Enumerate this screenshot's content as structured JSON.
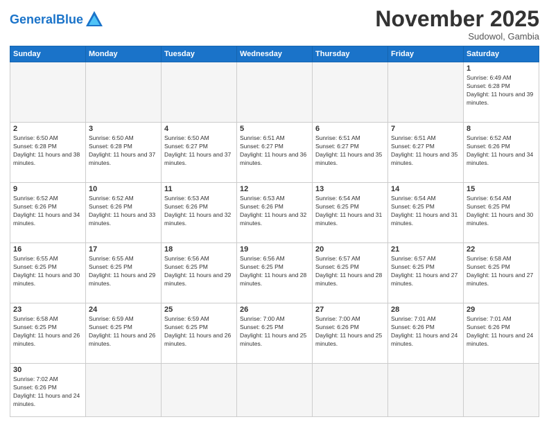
{
  "header": {
    "logo_general": "General",
    "logo_blue": "Blue",
    "month_title": "November 2025",
    "location": "Sudowol, Gambia"
  },
  "weekdays": [
    "Sunday",
    "Monday",
    "Tuesday",
    "Wednesday",
    "Thursday",
    "Friday",
    "Saturday"
  ],
  "weeks": [
    [
      {
        "day": "",
        "empty": true
      },
      {
        "day": "",
        "empty": true
      },
      {
        "day": "",
        "empty": true
      },
      {
        "day": "",
        "empty": true
      },
      {
        "day": "",
        "empty": true
      },
      {
        "day": "",
        "empty": true
      },
      {
        "day": "1",
        "sunrise": "Sunrise: 6:49 AM",
        "sunset": "Sunset: 6:28 PM",
        "daylight": "Daylight: 11 hours and 39 minutes."
      }
    ],
    [
      {
        "day": "2",
        "sunrise": "Sunrise: 6:50 AM",
        "sunset": "Sunset: 6:28 PM",
        "daylight": "Daylight: 11 hours and 38 minutes."
      },
      {
        "day": "3",
        "sunrise": "Sunrise: 6:50 AM",
        "sunset": "Sunset: 6:28 PM",
        "daylight": "Daylight: 11 hours and 37 minutes."
      },
      {
        "day": "4",
        "sunrise": "Sunrise: 6:50 AM",
        "sunset": "Sunset: 6:27 PM",
        "daylight": "Daylight: 11 hours and 37 minutes."
      },
      {
        "day": "5",
        "sunrise": "Sunrise: 6:51 AM",
        "sunset": "Sunset: 6:27 PM",
        "daylight": "Daylight: 11 hours and 36 minutes."
      },
      {
        "day": "6",
        "sunrise": "Sunrise: 6:51 AM",
        "sunset": "Sunset: 6:27 PM",
        "daylight": "Daylight: 11 hours and 35 minutes."
      },
      {
        "day": "7",
        "sunrise": "Sunrise: 6:51 AM",
        "sunset": "Sunset: 6:27 PM",
        "daylight": "Daylight: 11 hours and 35 minutes."
      },
      {
        "day": "8",
        "sunrise": "Sunrise: 6:52 AM",
        "sunset": "Sunset: 6:26 PM",
        "daylight": "Daylight: 11 hours and 34 minutes."
      }
    ],
    [
      {
        "day": "9",
        "sunrise": "Sunrise: 6:52 AM",
        "sunset": "Sunset: 6:26 PM",
        "daylight": "Daylight: 11 hours and 34 minutes."
      },
      {
        "day": "10",
        "sunrise": "Sunrise: 6:52 AM",
        "sunset": "Sunset: 6:26 PM",
        "daylight": "Daylight: 11 hours and 33 minutes."
      },
      {
        "day": "11",
        "sunrise": "Sunrise: 6:53 AM",
        "sunset": "Sunset: 6:26 PM",
        "daylight": "Daylight: 11 hours and 32 minutes."
      },
      {
        "day": "12",
        "sunrise": "Sunrise: 6:53 AM",
        "sunset": "Sunset: 6:26 PM",
        "daylight": "Daylight: 11 hours and 32 minutes."
      },
      {
        "day": "13",
        "sunrise": "Sunrise: 6:54 AM",
        "sunset": "Sunset: 6:25 PM",
        "daylight": "Daylight: 11 hours and 31 minutes."
      },
      {
        "day": "14",
        "sunrise": "Sunrise: 6:54 AM",
        "sunset": "Sunset: 6:25 PM",
        "daylight": "Daylight: 11 hours and 31 minutes."
      },
      {
        "day": "15",
        "sunrise": "Sunrise: 6:54 AM",
        "sunset": "Sunset: 6:25 PM",
        "daylight": "Daylight: 11 hours and 30 minutes."
      }
    ],
    [
      {
        "day": "16",
        "sunrise": "Sunrise: 6:55 AM",
        "sunset": "Sunset: 6:25 PM",
        "daylight": "Daylight: 11 hours and 30 minutes."
      },
      {
        "day": "17",
        "sunrise": "Sunrise: 6:55 AM",
        "sunset": "Sunset: 6:25 PM",
        "daylight": "Daylight: 11 hours and 29 minutes."
      },
      {
        "day": "18",
        "sunrise": "Sunrise: 6:56 AM",
        "sunset": "Sunset: 6:25 PM",
        "daylight": "Daylight: 11 hours and 29 minutes."
      },
      {
        "day": "19",
        "sunrise": "Sunrise: 6:56 AM",
        "sunset": "Sunset: 6:25 PM",
        "daylight": "Daylight: 11 hours and 28 minutes."
      },
      {
        "day": "20",
        "sunrise": "Sunrise: 6:57 AM",
        "sunset": "Sunset: 6:25 PM",
        "daylight": "Daylight: 11 hours and 28 minutes."
      },
      {
        "day": "21",
        "sunrise": "Sunrise: 6:57 AM",
        "sunset": "Sunset: 6:25 PM",
        "daylight": "Daylight: 11 hours and 27 minutes."
      },
      {
        "day": "22",
        "sunrise": "Sunrise: 6:58 AM",
        "sunset": "Sunset: 6:25 PM",
        "daylight": "Daylight: 11 hours and 27 minutes."
      }
    ],
    [
      {
        "day": "23",
        "sunrise": "Sunrise: 6:58 AM",
        "sunset": "Sunset: 6:25 PM",
        "daylight": "Daylight: 11 hours and 26 minutes."
      },
      {
        "day": "24",
        "sunrise": "Sunrise: 6:59 AM",
        "sunset": "Sunset: 6:25 PM",
        "daylight": "Daylight: 11 hours and 26 minutes."
      },
      {
        "day": "25",
        "sunrise": "Sunrise: 6:59 AM",
        "sunset": "Sunset: 6:25 PM",
        "daylight": "Daylight: 11 hours and 26 minutes."
      },
      {
        "day": "26",
        "sunrise": "Sunrise: 7:00 AM",
        "sunset": "Sunset: 6:25 PM",
        "daylight": "Daylight: 11 hours and 25 minutes."
      },
      {
        "day": "27",
        "sunrise": "Sunrise: 7:00 AM",
        "sunset": "Sunset: 6:26 PM",
        "daylight": "Daylight: 11 hours and 25 minutes."
      },
      {
        "day": "28",
        "sunrise": "Sunrise: 7:01 AM",
        "sunset": "Sunset: 6:26 PM",
        "daylight": "Daylight: 11 hours and 24 minutes."
      },
      {
        "day": "29",
        "sunrise": "Sunrise: 7:01 AM",
        "sunset": "Sunset: 6:26 PM",
        "daylight": "Daylight: 11 hours and 24 minutes."
      }
    ],
    [
      {
        "day": "30",
        "sunrise": "Sunrise: 7:02 AM",
        "sunset": "Sunset: 6:26 PM",
        "daylight": "Daylight: 11 hours and 24 minutes."
      },
      {
        "day": "",
        "empty": true
      },
      {
        "day": "",
        "empty": true
      },
      {
        "day": "",
        "empty": true
      },
      {
        "day": "",
        "empty": true
      },
      {
        "day": "",
        "empty": true
      },
      {
        "day": "",
        "empty": true
      }
    ]
  ]
}
